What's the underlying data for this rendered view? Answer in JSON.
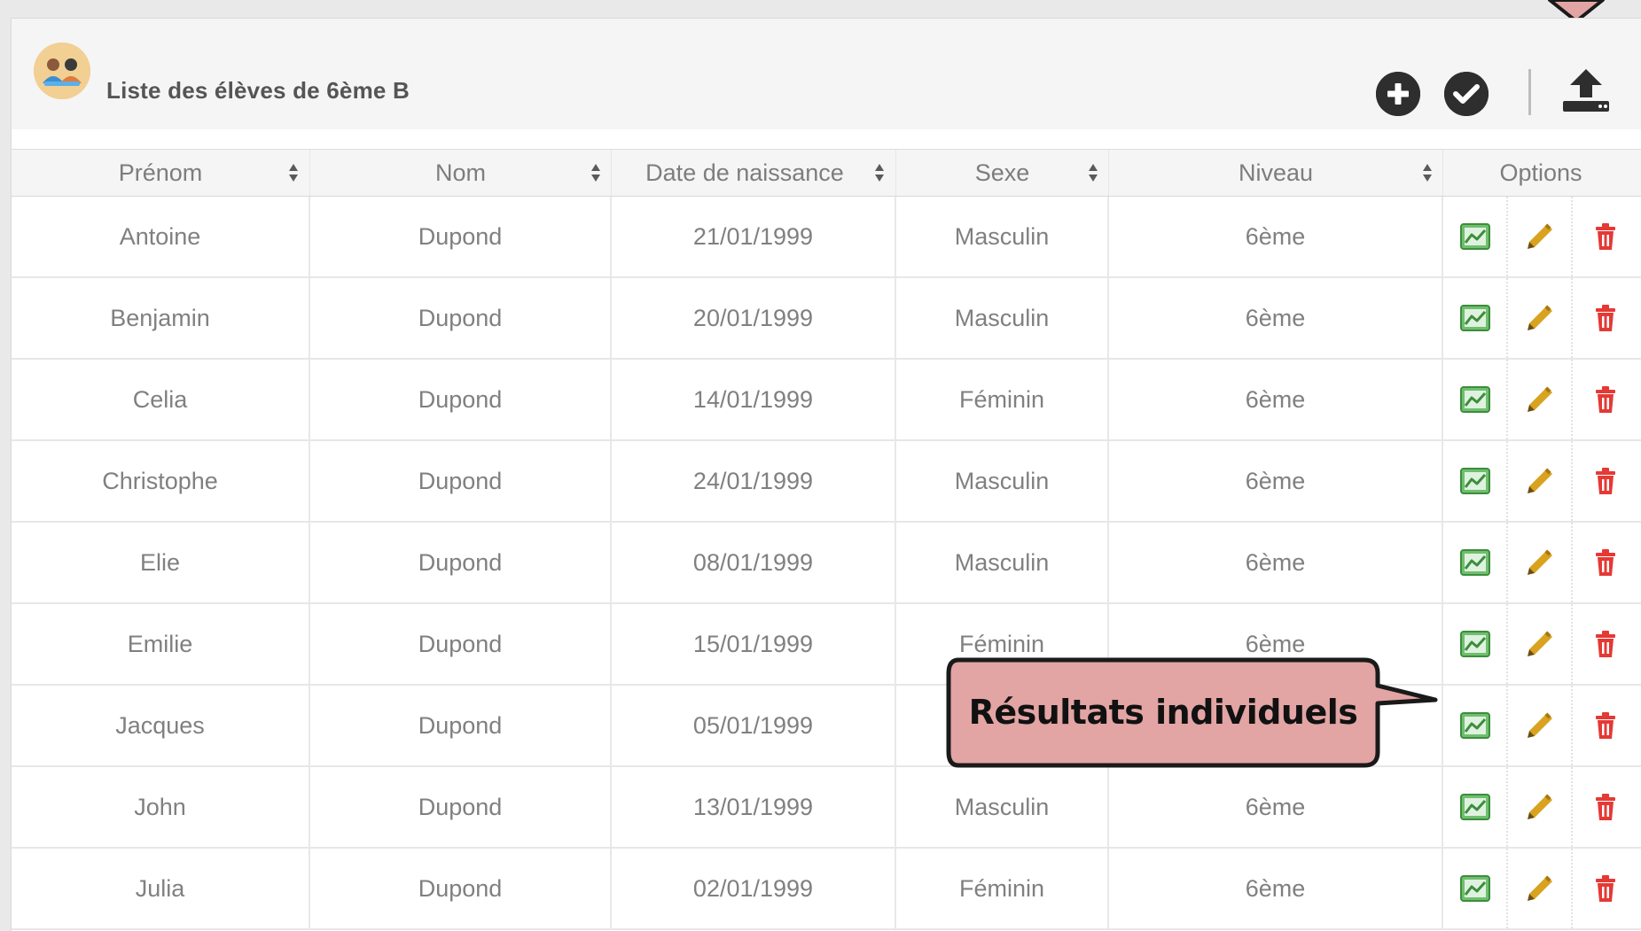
{
  "header": {
    "title": "Liste des élèves de 6ème B",
    "avatar_icon": "students-group-icon",
    "actions": [
      {
        "name": "add",
        "icon": "plus-circle-icon"
      },
      {
        "name": "validate",
        "icon": "check-circle-icon"
      },
      {
        "name": "export",
        "icon": "upload-icon"
      }
    ]
  },
  "table": {
    "columns": [
      {
        "label": "Prénom",
        "sortable": true
      },
      {
        "label": "Nom",
        "sortable": true
      },
      {
        "label": "Date de naissance",
        "sortable": true
      },
      {
        "label": "Sexe",
        "sortable": true
      },
      {
        "label": "Niveau",
        "sortable": true
      },
      {
        "label": "Options",
        "sortable": false
      }
    ],
    "rows": [
      {
        "prenom": "Antoine",
        "nom": "Dupond",
        "date": "21/01/1999",
        "sexe": "Masculin",
        "niveau": "6ème"
      },
      {
        "prenom": "Benjamin",
        "nom": "Dupond",
        "date": "20/01/1999",
        "sexe": "Masculin",
        "niveau": "6ème"
      },
      {
        "prenom": "Celia",
        "nom": "Dupond",
        "date": "14/01/1999",
        "sexe": "Féminin",
        "niveau": "6ème"
      },
      {
        "prenom": "Christophe",
        "nom": "Dupond",
        "date": "24/01/1999",
        "sexe": "Masculin",
        "niveau": "6ème"
      },
      {
        "prenom": "Elie",
        "nom": "Dupond",
        "date": "08/01/1999",
        "sexe": "Masculin",
        "niveau": "6ème"
      },
      {
        "prenom": "Emilie",
        "nom": "Dupond",
        "date": "15/01/1999",
        "sexe": "Féminin",
        "niveau": "6ème"
      },
      {
        "prenom": "Jacques",
        "nom": "Dupond",
        "date": "05/01/1999",
        "sexe": "",
        "niveau": ""
      },
      {
        "prenom": "John",
        "nom": "Dupond",
        "date": "13/01/1999",
        "sexe": "Masculin",
        "niveau": "6ème"
      },
      {
        "prenom": "Julia",
        "nom": "Dupond",
        "date": "02/01/1999",
        "sexe": "Féminin",
        "niveau": "6ème"
      }
    ],
    "row_actions": [
      {
        "name": "results",
        "icon": "chart-image-icon",
        "color": "#3c8d3c"
      },
      {
        "name": "edit",
        "icon": "pencil-icon",
        "color": "#d9a21f"
      },
      {
        "name": "delete",
        "icon": "trash-icon",
        "color": "#e53935"
      }
    ]
  },
  "callout": {
    "text": "Résultats individuels",
    "fill": "#e3a4a4",
    "border": "#1a1a1a"
  },
  "colors": {
    "header_bg": "#f5f5f5",
    "text": "#808080",
    "icon_dark": "#2e2e2e"
  }
}
